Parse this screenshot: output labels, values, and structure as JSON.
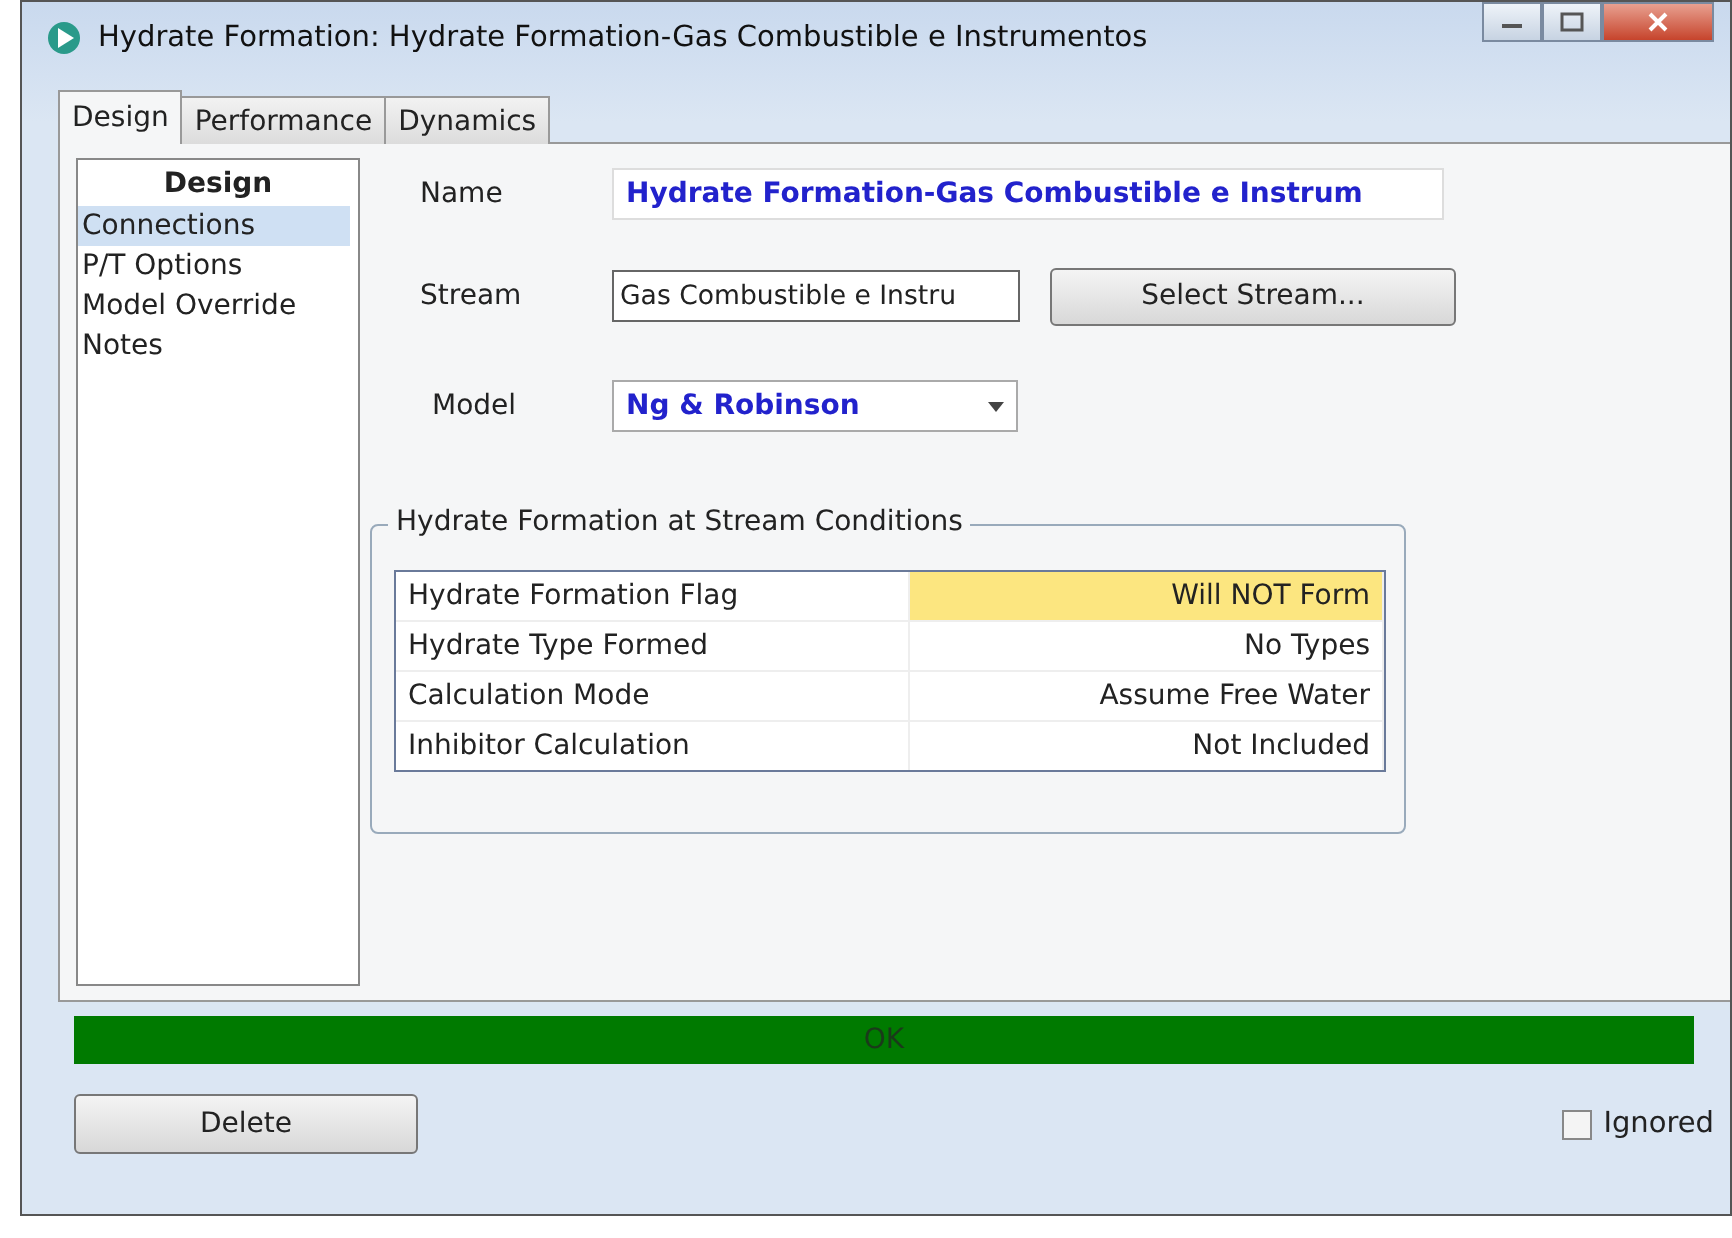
{
  "window": {
    "title": "Hydrate Formation: Hydrate Formation-Gas Combustible e Instrumentos"
  },
  "tabs": [
    {
      "label": "Design",
      "selected": true
    },
    {
      "label": "Performance",
      "selected": false
    },
    {
      "label": "Dynamics",
      "selected": false
    }
  ],
  "sidebar": {
    "heading": "Design",
    "items": [
      {
        "label": "Connections",
        "selected": true
      },
      {
        "label": "P/T Options",
        "selected": false
      },
      {
        "label": "Model Override",
        "selected": false
      },
      {
        "label": "Notes",
        "selected": false
      }
    ]
  },
  "name": {
    "label": "Name",
    "value": "Hydrate Formation-Gas Combustible e Instrum"
  },
  "stream": {
    "label": "Stream",
    "value": "Gas Combustible e Instru",
    "button": "Select Stream..."
  },
  "model": {
    "label": "Model",
    "value": "Ng & Robinson"
  },
  "group": {
    "title": "Hydrate Formation at Stream Conditions",
    "rows": [
      {
        "label": "Hydrate Formation Flag",
        "value": "Will NOT Form",
        "highlighted": true
      },
      {
        "label": "Hydrate Type Formed",
        "value": "No Types",
        "highlighted": false
      },
      {
        "label": "Calculation Mode",
        "value": "Assume Free Water",
        "highlighted": false
      },
      {
        "label": "Inhibitor Calculation",
        "value": "Not Included",
        "highlighted": false
      }
    ]
  },
  "status": {
    "text": "OK",
    "color": "#007a00"
  },
  "delete_button": "Delete",
  "ignored": {
    "label": "Ignored",
    "checked": false
  }
}
